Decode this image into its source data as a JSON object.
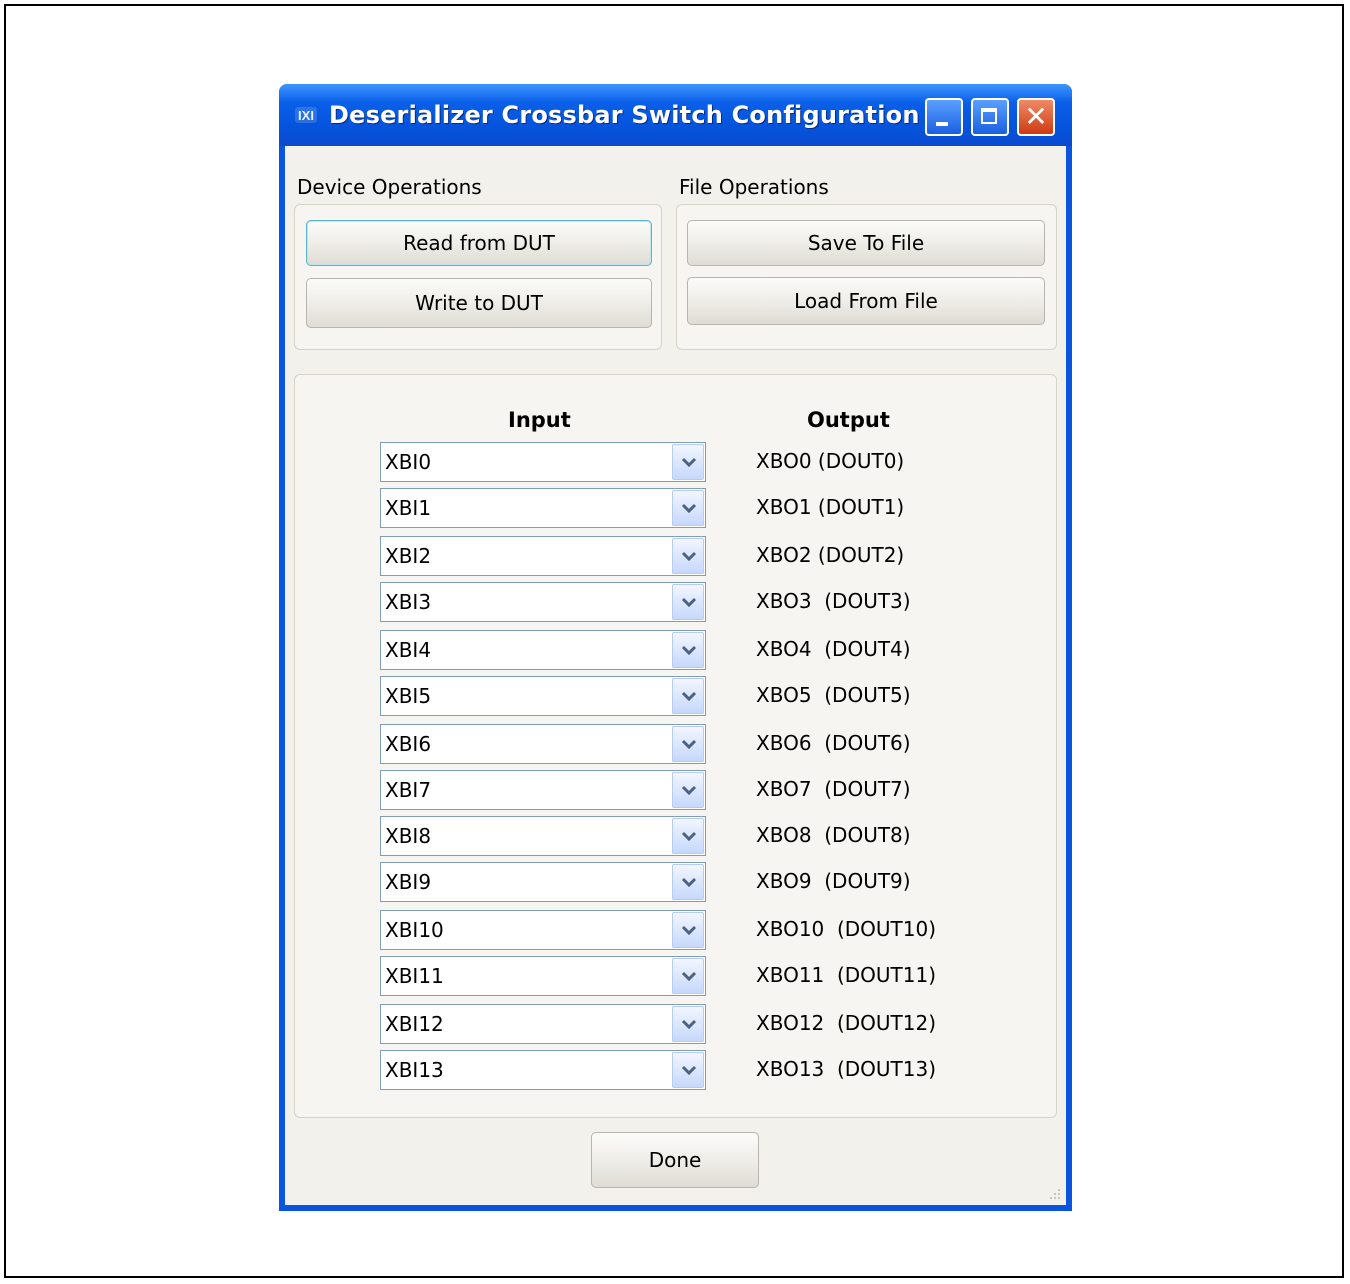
{
  "window": {
    "title": "Deserializer Crossbar Switch Configuration",
    "app_icon": "maxim-logo-icon",
    "title_color": "#ffffff",
    "titlebar_color": "#0a55e0",
    "controls": [
      "minimize-icon",
      "maximize-icon",
      "close-icon"
    ]
  },
  "device_operations": {
    "label": "Device Operations",
    "read_button": "Read from DUT",
    "write_button": "Write to DUT"
  },
  "file_operations": {
    "label": "File Operations",
    "save_button": "Save To File",
    "load_button": "Load From File"
  },
  "mapping": {
    "input_header": "Input",
    "output_header": "Output",
    "rows": [
      {
        "input": "XBI0",
        "output": "XBO0 (DOUT0)"
      },
      {
        "input": "XBI1",
        "output": "XBO1 (DOUT1)"
      },
      {
        "input": "XBI2",
        "output": "XBO2 (DOUT2)"
      },
      {
        "input": "XBI3",
        "output": "XBO3  (DOUT3)"
      },
      {
        "input": "XBI4",
        "output": "XBO4  (DOUT4)"
      },
      {
        "input": "XBI5",
        "output": "XBO5  (DOUT5)"
      },
      {
        "input": "XBI6",
        "output": "XBO6  (DOUT6)"
      },
      {
        "input": "XBI7",
        "output": "XBO7  (DOUT7)"
      },
      {
        "input": "XBI8",
        "output": "XBO8  (DOUT8)"
      },
      {
        "input": "XBI9",
        "output": "XBO9  (DOUT9)"
      },
      {
        "input": "XBI10",
        "output": "XBO10  (DOUT10)"
      },
      {
        "input": "XBI11",
        "output": "XBO11  (DOUT11)"
      },
      {
        "input": "XBI12",
        "output": "XBO12  (DOUT12)"
      },
      {
        "input": "XBI13",
        "output": "XBO13  (DOUT13)"
      }
    ]
  },
  "done_button": "Done"
}
